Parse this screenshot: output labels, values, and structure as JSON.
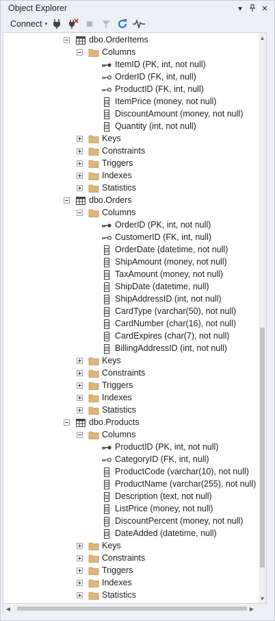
{
  "window": {
    "title": "Object Explorer",
    "pin_glyph": "↓",
    "close_glyph": "✕",
    "dropdown_glyph": "▾"
  },
  "toolbar": {
    "connect_label": "Connect",
    "connect_caret": "▾",
    "icons": [
      "connect-plug-icon",
      "disconnect-icon",
      "stop-icon",
      "filter-icon",
      "refresh-icon",
      "activity-monitor-icon"
    ],
    "accent_blue": "#1c7ad4",
    "accent_red": "#c42b1c"
  },
  "tree": {
    "nodes": [
      {
        "level": 0,
        "type": "table",
        "state": "expanded",
        "label": "dbo.OrderItems"
      },
      {
        "level": 1,
        "type": "folder",
        "state": "expanded",
        "label": "Columns"
      },
      {
        "level": 2,
        "type": "pk",
        "label": "ItemID (PK, int, not null)"
      },
      {
        "level": 2,
        "type": "fk",
        "label": "OrderID (FK, int, null)"
      },
      {
        "level": 2,
        "type": "fk",
        "label": "ProductID (FK, int, null)"
      },
      {
        "level": 2,
        "type": "col",
        "label": "ItemPrice (money, not null)"
      },
      {
        "level": 2,
        "type": "col",
        "label": "DiscountAmount (money, not null)"
      },
      {
        "level": 2,
        "type": "col",
        "label": "Quantity (int, not null)"
      },
      {
        "level": 1,
        "type": "folder",
        "state": "collapsed",
        "label": "Keys"
      },
      {
        "level": 1,
        "type": "folder",
        "state": "collapsed",
        "label": "Constraints"
      },
      {
        "level": 1,
        "type": "folder",
        "state": "collapsed",
        "label": "Triggers"
      },
      {
        "level": 1,
        "type": "folder",
        "state": "collapsed",
        "label": "Indexes"
      },
      {
        "level": 1,
        "type": "folder",
        "state": "collapsed",
        "label": "Statistics"
      },
      {
        "level": 0,
        "type": "table",
        "state": "expanded",
        "label": "dbo.Orders"
      },
      {
        "level": 1,
        "type": "folder",
        "state": "expanded",
        "label": "Columns"
      },
      {
        "level": 2,
        "type": "pk",
        "label": "OrderID (PK, int, not null)"
      },
      {
        "level": 2,
        "type": "fk",
        "label": "CustomerID (FK, int, null)"
      },
      {
        "level": 2,
        "type": "col",
        "label": "OrderDate (datetime, not null)"
      },
      {
        "level": 2,
        "type": "col",
        "label": "ShipAmount (money, not null)"
      },
      {
        "level": 2,
        "type": "col",
        "label": "TaxAmount (money, not null)"
      },
      {
        "level": 2,
        "type": "col",
        "label": "ShipDate (datetime, null)"
      },
      {
        "level": 2,
        "type": "col",
        "label": "ShipAddressID (int, not null)"
      },
      {
        "level": 2,
        "type": "col",
        "label": "CardType (varchar(50), not null)"
      },
      {
        "level": 2,
        "type": "col",
        "label": "CardNumber (char(16), not null)"
      },
      {
        "level": 2,
        "type": "col",
        "label": "CardExpires (char(7), not null)"
      },
      {
        "level": 2,
        "type": "col",
        "label": "BillingAddressID (int, not null)"
      },
      {
        "level": 1,
        "type": "folder",
        "state": "collapsed",
        "label": "Keys"
      },
      {
        "level": 1,
        "type": "folder",
        "state": "collapsed",
        "label": "Constraints"
      },
      {
        "level": 1,
        "type": "folder",
        "state": "collapsed",
        "label": "Triggers"
      },
      {
        "level": 1,
        "type": "folder",
        "state": "collapsed",
        "label": "Indexes"
      },
      {
        "level": 1,
        "type": "folder",
        "state": "collapsed",
        "label": "Statistics"
      },
      {
        "level": 0,
        "type": "table",
        "state": "expanded",
        "label": "dbo.Products"
      },
      {
        "level": 1,
        "type": "folder",
        "state": "expanded",
        "label": "Columns"
      },
      {
        "level": 2,
        "type": "pk",
        "label": "ProductID (PK, int, not null)"
      },
      {
        "level": 2,
        "type": "fk",
        "label": "CategoryID (FK, int, null)"
      },
      {
        "level": 2,
        "type": "col",
        "label": "ProductCode (varchar(10), not null)"
      },
      {
        "level": 2,
        "type": "col",
        "label": "ProductName (varchar(255), not null)"
      },
      {
        "level": 2,
        "type": "col",
        "label": "Description (text, not null)"
      },
      {
        "level": 2,
        "type": "col",
        "label": "ListPrice (money, not null)"
      },
      {
        "level": 2,
        "type": "col",
        "label": "DiscountPercent (money, not null)"
      },
      {
        "level": 2,
        "type": "col",
        "label": "DateAdded (datetime, null)"
      },
      {
        "level": 1,
        "type": "folder",
        "state": "collapsed",
        "label": "Keys"
      },
      {
        "level": 1,
        "type": "folder",
        "state": "collapsed",
        "label": "Constraints"
      },
      {
        "level": 1,
        "type": "folder",
        "state": "collapsed",
        "label": "Triggers"
      },
      {
        "level": 1,
        "type": "folder",
        "state": "collapsed",
        "label": "Indexes"
      },
      {
        "level": 1,
        "type": "folder",
        "state": "collapsed",
        "label": "Statistics"
      }
    ]
  },
  "colors": {
    "folder": "#dcb67a",
    "folder_dark": "#c09553",
    "icon_dark": "#424242"
  }
}
